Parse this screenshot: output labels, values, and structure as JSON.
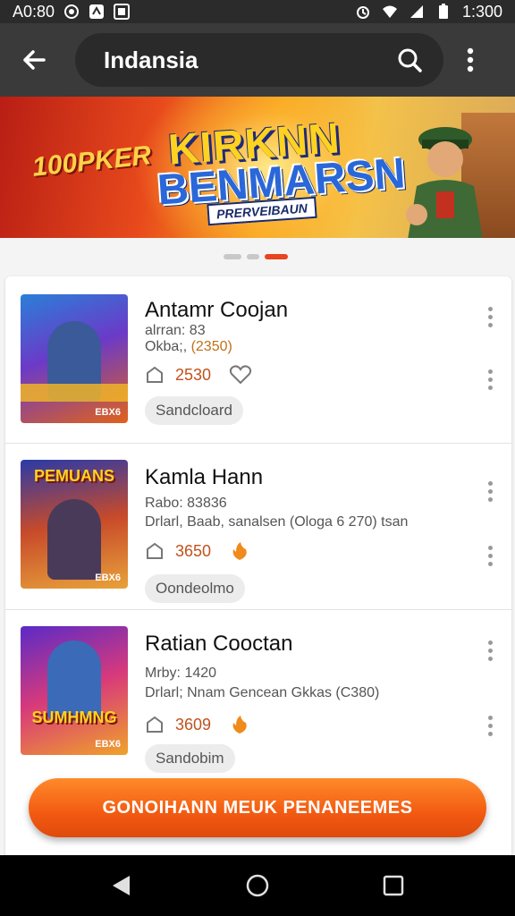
{
  "status_bar": {
    "time_left": "A0:80",
    "time_right": "1:300"
  },
  "app_bar": {
    "title": "Indansia"
  },
  "banner": {
    "tag": "100PKER",
    "headline_1": "KIRKNN",
    "headline_2": "BENMARSN",
    "sub": "PRERVEIBAUN"
  },
  "carousel": {
    "count": 3,
    "active": 2
  },
  "items": [
    {
      "title": "Antamr Coojan",
      "meta1": "alrran: 83",
      "meta2_a": "Okba;, ",
      "meta2_b": "(2350)",
      "price": "2530",
      "chip": "Sandcloard",
      "thumb_cap": "EBX6",
      "thumb_text": ""
    },
    {
      "title": "Kamla Hann",
      "meta1": "Rabo: 83836",
      "meta2_a": "Drlarl, Baab, sanalsen (Ologa 6 270) tsan",
      "meta2_b": "",
      "price": "3650",
      "chip": "Oondeolmo",
      "thumb_cap": "EBX6",
      "thumb_text": "PEMUANS"
    },
    {
      "title": "Ratian Cooctan",
      "meta1": "Mrby: 1420",
      "meta2_a": "Drlarl; Nnam Gencean Gkkas (C380)",
      "meta2_b": "",
      "price": "3609",
      "chip": "Sandobim",
      "thumb_cap": "EBX6",
      "thumb_text": "SUMHMNG"
    }
  ],
  "cta": {
    "label": "GONOIHANN MEUK PENANEEMES"
  },
  "colors": {
    "accent": "#f25a12",
    "price": "#c0521c",
    "app_bar": "#3a3a3a"
  }
}
